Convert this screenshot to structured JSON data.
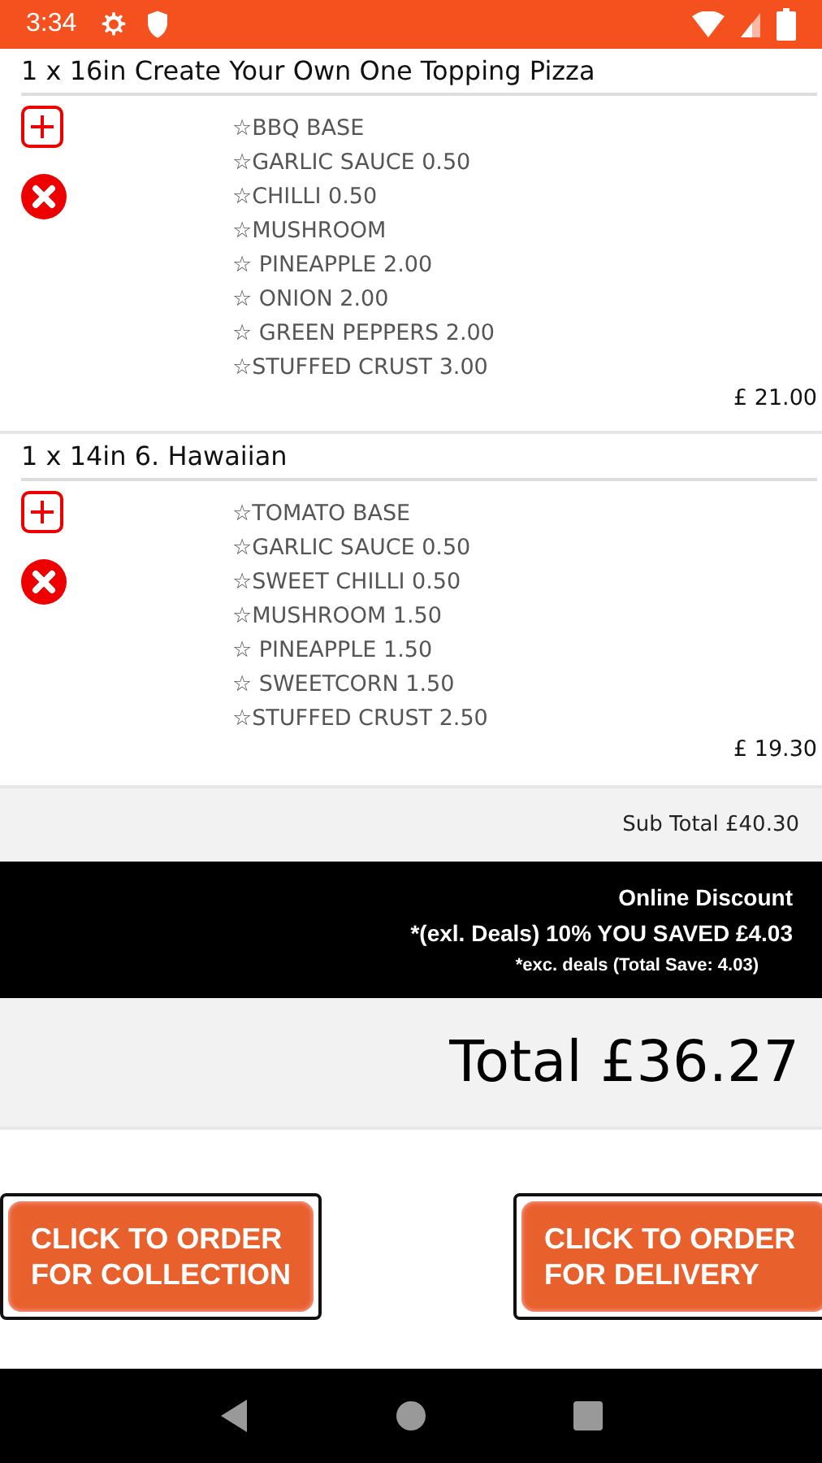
{
  "status_bar": {
    "time": "3:34"
  },
  "order_items": [
    {
      "title": "1 x 16in Create Your Own One Topping Pizza",
      "toppings": [
        "☆BBQ BASE",
        "☆GARLIC SAUCE 0.50",
        "☆CHILLI 0.50",
        "☆MUSHROOM",
        "☆ PINEAPPLE 2.00",
        "☆ ONION 2.00",
        "☆ GREEN PEPPERS 2.00",
        "☆STUFFED CRUST 3.00"
      ],
      "price": "£ 21.00"
    },
    {
      "title": "1 x 14in 6. Hawaiian",
      "toppings": [
        "☆TOMATO BASE",
        "☆GARLIC SAUCE 0.50",
        "☆SWEET CHILLI 0.50",
        "☆MUSHROOM 1.50",
        "☆ PINEAPPLE 1.50",
        "☆ SWEETCORN 1.50",
        "☆STUFFED CRUST 2.50"
      ],
      "price": "£ 19.30"
    }
  ],
  "subtotal": "Sub Total £40.30",
  "discount": {
    "title": "Online Discount",
    "line": "*(exl. Deals) 10% YOU SAVED £4.03",
    "note": "*exc. deals (Total Save: 4.03)"
  },
  "total": "Total £36.27",
  "buttons": [
    "CLICK TO ORDER FOR COLLECTION",
    "CLICK TO ORDER FOR DELIVERY"
  ]
}
